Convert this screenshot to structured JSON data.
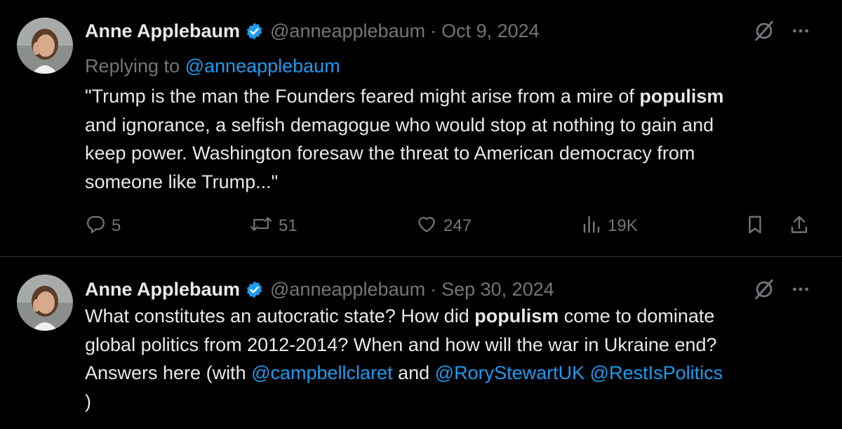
{
  "colors": {
    "background": "#000000",
    "text": "#e7e9ea",
    "muted": "#71767b",
    "link": "#1d9bf0",
    "divider": "#2f3336"
  },
  "tweets": [
    {
      "author_name": "Anne Applebaum",
      "handle": "@anneapplebaum",
      "separator": "·",
      "date": "Oct 9, 2024",
      "replying_to_label": "Replying to",
      "replying_to_handle": "@anneapplebaum",
      "body_lines": [
        {
          "a": "\"Trump is the man the Founders feared might arise from a mire of ",
          "b": "populism"
        },
        {
          "a": "and ignorance, a selfish demagogue who would stop at nothing to gain and"
        },
        {
          "a": "keep power. Washington foresaw the threat to American democracy from"
        },
        {
          "a": "someone like Trump...\""
        }
      ],
      "stats": {
        "replies": "5",
        "reposts": "51",
        "likes": "247",
        "views": "19K"
      },
      "icons": {
        "verified": "verified-badge-icon",
        "grok": "grok-icon",
        "more": "more-icon",
        "reply": "reply-icon",
        "repost": "repost-icon",
        "like": "like-icon",
        "views": "views-icon",
        "bookmark": "bookmark-icon",
        "share": "share-icon"
      }
    },
    {
      "author_name": "Anne Applebaum",
      "handle": "@anneapplebaum",
      "separator": "·",
      "date": "Sep 30, 2024",
      "body_line1": {
        "a": "What constitutes an autocratic state? How did ",
        "b": "populism",
        "c": " come to dominate"
      },
      "body_line2": "global politics from 2012-2014? When and how will the war in Ukraine end?",
      "body_line3": {
        "a": "Answers here (with ",
        "link1": "@campbellclaret",
        "b": " and ",
        "link2": "@RoryStewartUK",
        "c": " ",
        "link3": "@RestIsPolitics"
      },
      "body_line4": ")"
    }
  ]
}
